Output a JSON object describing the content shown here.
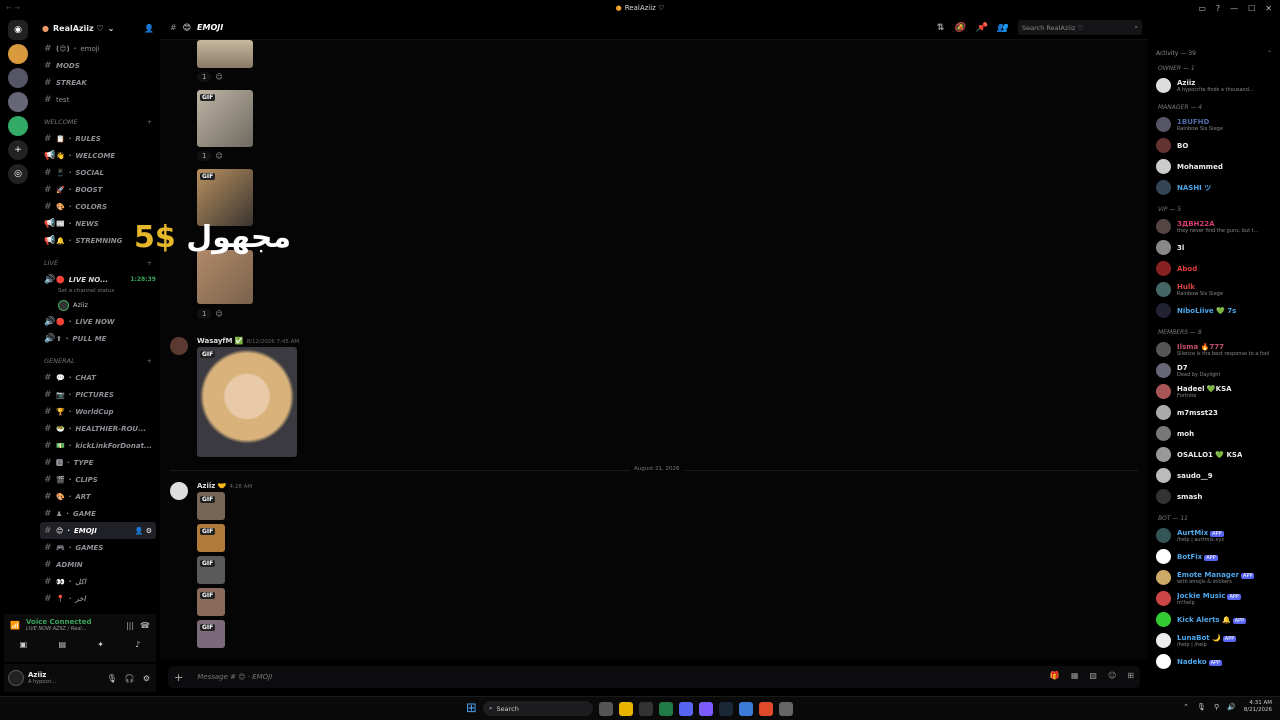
{
  "window": {
    "title": "RealAziiz ♡"
  },
  "server": {
    "name": "RealAziiz ♡"
  },
  "channels_top": [
    {
      "emoji": "(😊)",
      "name": "emoji",
      "style": "plain"
    },
    {
      "emoji": "",
      "name": "MODS"
    },
    {
      "emoji": "",
      "name": "STREAK"
    },
    {
      "emoji": "",
      "name": "test",
      "style": "plain"
    }
  ],
  "categories": {
    "welcome": "WELCOME",
    "live": "LIVE",
    "general": "GENERAL"
  },
  "welcome_channels": [
    {
      "icon": "#",
      "emoji": "📋",
      "name": "RULES"
    },
    {
      "icon": "📢",
      "emoji": "👋",
      "name": "WELCOME"
    },
    {
      "icon": "#",
      "emoji": "📱",
      "name": "SOCIAL"
    },
    {
      "icon": "#",
      "emoji": "🚀",
      "name": "BOOST"
    },
    {
      "icon": "#",
      "emoji": "🎨",
      "name": "COLORS"
    },
    {
      "icon": "📢",
      "emoji": "📰",
      "name": "NEWS"
    },
    {
      "icon": "📢",
      "emoji": "🔔",
      "name": "STREMNING"
    }
  ],
  "live_channels": {
    "voice_name": "LIVE NO...",
    "voice_time": "1:28:39",
    "voice_status": "Set a channel status",
    "voice_user": "Aziiz",
    "others": [
      {
        "icon": "🔊",
        "emoji": "🔴",
        "name": "LIVE NOW"
      },
      {
        "icon": "🔊",
        "emoji": "⬆",
        "name": "PULL ME"
      }
    ]
  },
  "general_channels": [
    {
      "emoji": "💬",
      "name": "CHAT"
    },
    {
      "emoji": "📷",
      "name": "PICTURES"
    },
    {
      "emoji": "🏆",
      "name": "WorldCup"
    },
    {
      "emoji": "🥗",
      "name": "HEALTHIER-ROU..."
    },
    {
      "emoji": "💵",
      "name": "kickLinkForDonat..."
    },
    {
      "emoji": "🅰",
      "name": "TYPE"
    },
    {
      "emoji": "🎬",
      "name": "CLIPS"
    },
    {
      "emoji": "🎨",
      "name": "ART"
    },
    {
      "emoji": "♟",
      "name": "GAME"
    },
    {
      "emoji": "😊",
      "name": "EMOJI",
      "active": true
    },
    {
      "emoji": "🎮",
      "name": "GAMES"
    },
    {
      "emoji": "",
      "name": "ADMIN"
    },
    {
      "emoji": "👀",
      "name": "اكل"
    },
    {
      "emoji": "📍",
      "name": "اخر"
    }
  ],
  "voice_panel": {
    "status": "Voice Connected",
    "channel": "LIVE NOW AZIIZ / Real..."
  },
  "user_panel": {
    "name": "Aziiz",
    "status": "A hypocri..."
  },
  "channel_header": {
    "emoji": "😊",
    "name": "EMOJI",
    "search_placeholder": "Search RealAziiz ♡"
  },
  "messages": [
    {
      "user": "WasayfM",
      "time": "8/12/2026 7:45 AM"
    },
    {
      "user": "Aziiz",
      "time": "4:28 AM"
    }
  ],
  "reaction_count": "1",
  "gif_label": "GIF",
  "date_divider": "August 21, 2026",
  "overlay": {
    "money": "5$",
    "arabic": "مجهول"
  },
  "composer": {
    "placeholder": "Message # 😊 · EMOJI"
  },
  "members_header": "Activity — 39",
  "member_groups": [
    {
      "label": "OWNER — 1",
      "members": [
        {
          "name": "Aziiz",
          "status": "A hypocrite finds a thousand...",
          "color": "#e9e9e9",
          "av": "#ddd"
        }
      ]
    },
    {
      "label": "MANAGER — 4",
      "members": [
        {
          "name": "1BUFHD",
          "status": "Rainbow Six Siege",
          "color": "#4f6ea8",
          "av": "#556"
        },
        {
          "name": "BO",
          "status": "",
          "color": "#eee",
          "av": "#633"
        },
        {
          "name": "Mohammed",
          "status": "",
          "color": "#eee",
          "av": "#ccc"
        },
        {
          "name": "NASHI ツ",
          "status": "",
          "color": "#4ea6e9",
          "av": "#345"
        }
      ]
    },
    {
      "label": "VIP — 5",
      "members": [
        {
          "name": "ЗДВН22А",
          "status": "they never find the guns, but t...",
          "color": "#d63d6c",
          "av": "#544"
        },
        {
          "name": "3l",
          "status": "",
          "color": "#eee",
          "av": "#888"
        },
        {
          "name": "Abod",
          "status": "",
          "color": "#e23c3c",
          "av": "#822"
        },
        {
          "name": "Hulk",
          "status": "Rainbow Six Siege",
          "color": "#d8453e",
          "av": "#466"
        },
        {
          "name": "NiboLiive 💚 7s",
          "status": "",
          "color": "#4ea6e9",
          "av": "#223"
        }
      ]
    },
    {
      "label": "MEMBERS — 8",
      "members": [
        {
          "name": "Ilsma 🔥777",
          "status": "Silence is the best response to a fool",
          "color": "#c54f6e",
          "av": "#555"
        },
        {
          "name": "D7",
          "status": "Dead by Daylight",
          "color": "#eee",
          "av": "#667"
        },
        {
          "name": "Hadeel 💚KSA",
          "status": "Fortnite",
          "color": "#eee",
          "av": "#a55"
        },
        {
          "name": "m7msst23",
          "status": "",
          "color": "#eee",
          "av": "#aaa"
        },
        {
          "name": "moh",
          "status": "",
          "color": "#eee",
          "av": "#777"
        },
        {
          "name": "OSALLO1 💚 KSA",
          "status": "",
          "color": "#eee",
          "av": "#999"
        },
        {
          "name": "saudo__9",
          "status": "",
          "color": "#eee",
          "av": "#bbb"
        },
        {
          "name": "smash",
          "status": "",
          "color": "#eee",
          "av": "#333"
        }
      ]
    },
    {
      "label": "BOT — 11",
      "members": [
        {
          "name": "AurtMix",
          "status": "/help | aurtmix.xyz",
          "color": "#4ea6e9",
          "av": "#355",
          "app": "APP"
        },
        {
          "name": "BotFix",
          "status": "",
          "color": "#4ea6e9",
          "av": "#fff",
          "app": "APP"
        },
        {
          "name": "Emote Manager",
          "status": "with emojis & stickers",
          "color": "#4ea6e9",
          "av": "#ca6",
          "app": "APP"
        },
        {
          "name": "Jockie Music",
          "status": "m!help",
          "color": "#4ea6e9",
          "av": "#c44",
          "app": "APP"
        },
        {
          "name": "Kick Alerts 🔔",
          "status": "",
          "color": "#4ea6e9",
          "av": "#3c3",
          "app": "APP"
        },
        {
          "name": "LunaBot 🌙",
          "status": "/help | /help",
          "color": "#4ea6e9",
          "av": "#eee",
          "app": "APP"
        },
        {
          "name": "Nadeko",
          "status": "",
          "color": "#4ea6e9",
          "av": "#fff",
          "app": "APP"
        }
      ]
    }
  ],
  "taskbar": {
    "search": "Search",
    "time": "4:31 AM",
    "date": "8/21/2026"
  }
}
